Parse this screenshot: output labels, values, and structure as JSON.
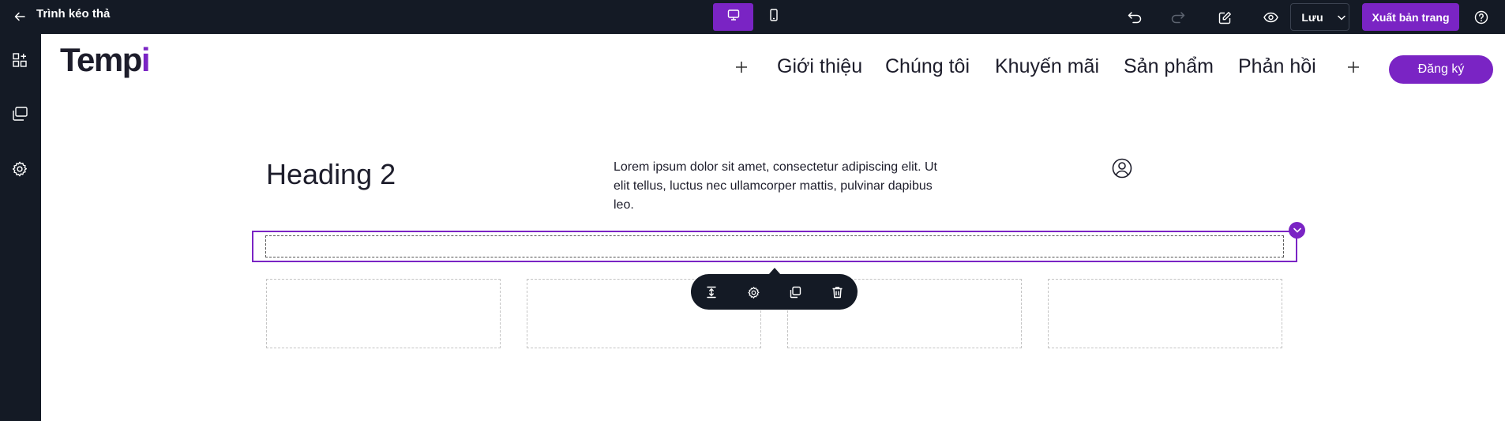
{
  "app": {
    "title": "Trình kéo thả"
  },
  "topbar": {
    "save_label": "Lưu",
    "publish_label": "Xuất bản trang",
    "icons": [
      "back-arrow-icon",
      "desktop-icon",
      "mobile-icon",
      "undo-icon",
      "redo-icon",
      "edit-icon",
      "preview-eye-icon",
      "chevron-down-icon",
      "help-icon"
    ]
  },
  "leftrail": {
    "icons": [
      "widgets-icon",
      "layers-icon",
      "settings-gear-icon"
    ]
  },
  "site": {
    "logo_main": "Temp",
    "logo_accent": "i",
    "nav": [
      "Giới thiệu",
      "Chúng tôi",
      "Khuyến mãi",
      "Sản phẩm",
      "Phản hồi"
    ],
    "signup_label": "Đăng ký"
  },
  "content": {
    "heading": "Heading 2",
    "lorem": "Lorem ipsum dolor sit amet, consectetur adipiscing elit. Ut elit tellus, luctus nec ullamcorper mattis, pulvinar dapibus leo."
  },
  "colors": {
    "topbar_bg": "#141a25",
    "accent": "#7a24c4",
    "text": "#1d1d2b"
  }
}
